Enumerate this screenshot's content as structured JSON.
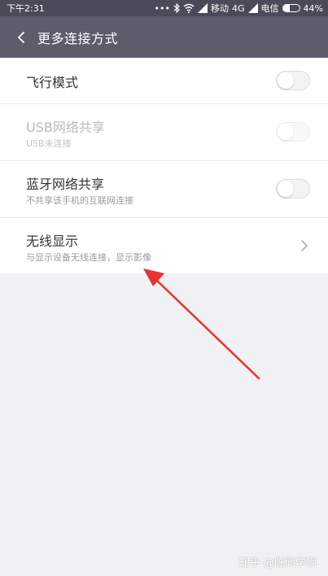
{
  "status_bar": {
    "time": "下午2:31",
    "dots": "•••",
    "carrier1": "移动",
    "network": "4G",
    "carrier2": "电信",
    "battery_percent": "44%",
    "battery_level": 0.44,
    "icons": [
      "bluetooth-icon",
      "wifi-icon",
      "signal-icon",
      "signal-icon",
      "battery-icon"
    ]
  },
  "header": {
    "back_icon": "chevron-left-icon",
    "title": "更多连接方式"
  },
  "items": [
    {
      "title": "飞行模式",
      "subtitle": "",
      "control": "toggle",
      "toggle_on": false,
      "enabled": true
    },
    {
      "title": "USB网络共享",
      "subtitle": "USB未连接",
      "control": "toggle",
      "toggle_on": false,
      "enabled": false
    },
    {
      "title": "蓝牙网络共享",
      "subtitle": "不共享该手机的互联网连接",
      "control": "toggle",
      "toggle_on": false,
      "enabled": true
    },
    {
      "title": "无线显示",
      "subtitle": "与显示设备无线连接，显示影像",
      "control": "chevron",
      "icon": "chevron-right-icon",
      "enabled": true
    }
  ],
  "annotation": {
    "arrow_color": "#e8322f"
  },
  "watermark": "知乎 @陈同学啊",
  "colors": {
    "status_bar": "#4b4a58",
    "header": "#5d5c6b",
    "background": "#f1f1f3"
  }
}
